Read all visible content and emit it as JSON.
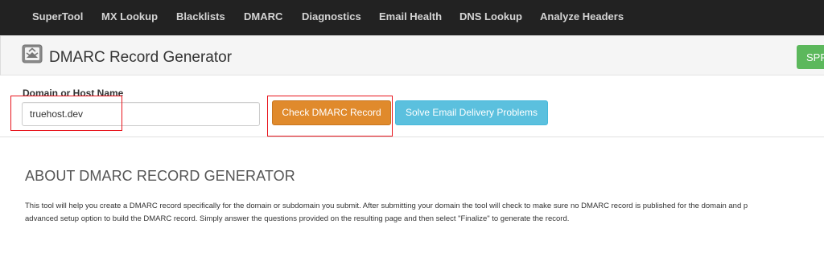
{
  "nav": {
    "items": [
      {
        "label": "SuperTool"
      },
      {
        "label": "MX Lookup"
      },
      {
        "label": "Blacklists"
      },
      {
        "label": "DMARC"
      },
      {
        "label": "Diagnostics"
      },
      {
        "label": "Email Health"
      },
      {
        "label": "DNS Lookup"
      },
      {
        "label": "Analyze Headers"
      }
    ],
    "bg_color": "#222222"
  },
  "header": {
    "title": "DMARC Record Generator",
    "icon": "envelope-badge-icon",
    "right_button_label": "SPF"
  },
  "form": {
    "label": "Domain or Host Name",
    "domain_value": "truehost.dev",
    "check_button_label": "Check DMARC Record",
    "solve_button_label": "Solve Email Delivery Problems",
    "check_button_color": "#e08a2c",
    "solve_button_color": "#5bc0de"
  },
  "about": {
    "title": "ABOUT DMARC RECORD GENERATOR",
    "line1": "This tool will help you create a DMARC record specifically for the domain or subdomain you submit. After submitting your domain the tool will check to make sure no DMARC record is published for the domain and p",
    "line2": "advanced setup option to build the DMARC record. Simply answer the questions provided on the resulting page and then select \"Finalize\" to generate the record."
  },
  "annotation_color": "#e8141c"
}
